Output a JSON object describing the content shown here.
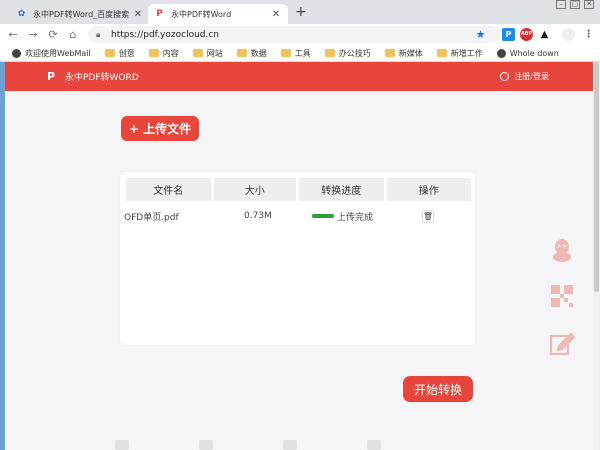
{
  "browser": {
    "tabs": [
      {
        "title": "永中PDF转Word_百度搜索",
        "favicon": "baidu-paw-icon"
      },
      {
        "title": "永中PDF转Word",
        "favicon": "yozo-p-icon"
      }
    ],
    "new_tab": "+",
    "address": "https://pdf.yozocloud.cn",
    "bookmarks": [
      {
        "label": "欢迎使用WebMail",
        "icon": "globe-icon"
      },
      {
        "label": "创意",
        "icon": "folder-icon"
      },
      {
        "label": "内容",
        "icon": "folder-icon"
      },
      {
        "label": "网站",
        "icon": "folder-icon"
      },
      {
        "label": "数据",
        "icon": "folder-icon"
      },
      {
        "label": "工具",
        "icon": "folder-icon"
      },
      {
        "label": "办公技巧",
        "icon": "folder-icon"
      },
      {
        "label": "新媒体",
        "icon": "folder-icon"
      },
      {
        "label": "新增工作",
        "icon": "folder-icon"
      },
      {
        "label": "Whole down",
        "icon": "globe-icon"
      }
    ]
  },
  "site": {
    "logo_text": "永中PDF转WORD",
    "login_label": "注册/登录",
    "accent": "#e8453c",
    "upload_label": "+ 上传文件",
    "start_label": "开始转换"
  },
  "table": {
    "headers": [
      "文件名",
      "大小",
      "转换进度",
      "操作"
    ],
    "rows": [
      {
        "name": "OFD单页.pdf",
        "size": "0.73M",
        "status": "上传完成",
        "progress": 1.0
      }
    ]
  },
  "side_tools": [
    "qq-icon",
    "qrcode-icon",
    "edit-icon"
  ]
}
